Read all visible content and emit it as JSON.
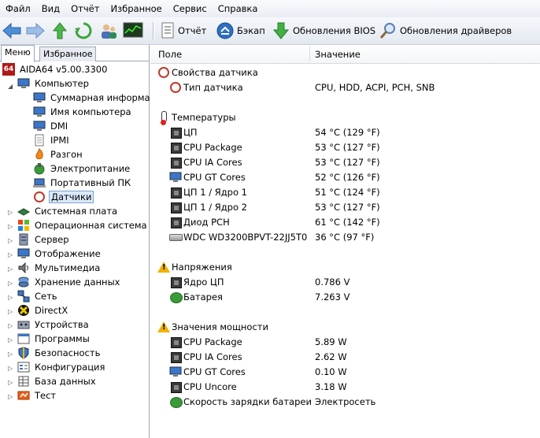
{
  "menu": [
    "Файл",
    "Вид",
    "Отчёт",
    "Избранное",
    "Сервис",
    "Справка"
  ],
  "toolbar": {
    "report": "Отчёт",
    "backup": "Бэкап",
    "bios_updates": "Обновления BIOS",
    "driver_updates": "Обновления драйверов"
  },
  "tabs": {
    "menu": "Меню",
    "favorites": "Избранное"
  },
  "tree": {
    "root": "AIDA64 v5.00.3300",
    "computer": "Компьютер",
    "children": [
      "Суммарная информац",
      "Имя компьютера",
      "DMI",
      "IPMI",
      "Разгон",
      "Электропитание",
      "Портативный ПК",
      "Датчики"
    ],
    "top": [
      "Системная плата",
      "Операционная система",
      "Сервер",
      "Отображение",
      "Мультимедиа",
      "Хранение данных",
      "Сеть",
      "DirectX",
      "Устройства",
      "Программы",
      "Безопасность",
      "Конфигурация",
      "База данных",
      "Тест"
    ]
  },
  "columns": {
    "field": "Поле",
    "value": "Значение"
  },
  "sections": {
    "sensor_props": "Свойства датчика",
    "sensor_type_label": "Тип датчика",
    "sensor_type_value": "CPU, HDD, ACPI, PCH, SNB",
    "temps": "Температуры",
    "voltages": "Напряжения",
    "power": "Значения мощности"
  },
  "temperatures": [
    {
      "label": "ЦП",
      "value": "54 °C  (129 °F)"
    },
    {
      "label": "CPU Package",
      "value": "53 °C  (127 °F)"
    },
    {
      "label": "CPU IA Cores",
      "value": "53 °C  (127 °F)"
    },
    {
      "label": "CPU GT Cores",
      "value": "52 °C  (126 °F)"
    },
    {
      "label": "ЦП 1 / Ядро 1",
      "value": "51 °C  (124 °F)"
    },
    {
      "label": "ЦП 1 / Ядро 2",
      "value": "53 °C  (127 °F)"
    },
    {
      "label": "Диод PCH",
      "value": "61 °C  (142 °F)"
    },
    {
      "label": "WDC WD3200BPVT-22JJ5T0",
      "value": "36 °C  (97 °F)"
    }
  ],
  "voltages": [
    {
      "label": "Ядро ЦП",
      "value": "0.786 V"
    },
    {
      "label": "Батарея",
      "value": "7.263 V"
    }
  ],
  "power": [
    {
      "label": "CPU Package",
      "value": "5.89 W"
    },
    {
      "label": "CPU IA Cores",
      "value": "2.62 W"
    },
    {
      "label": "CPU GT Cores",
      "value": "0.10 W"
    },
    {
      "label": "CPU Uncore",
      "value": "3.18 W"
    },
    {
      "label": "Скорость зарядки батареи",
      "value": "Электросеть"
    }
  ]
}
